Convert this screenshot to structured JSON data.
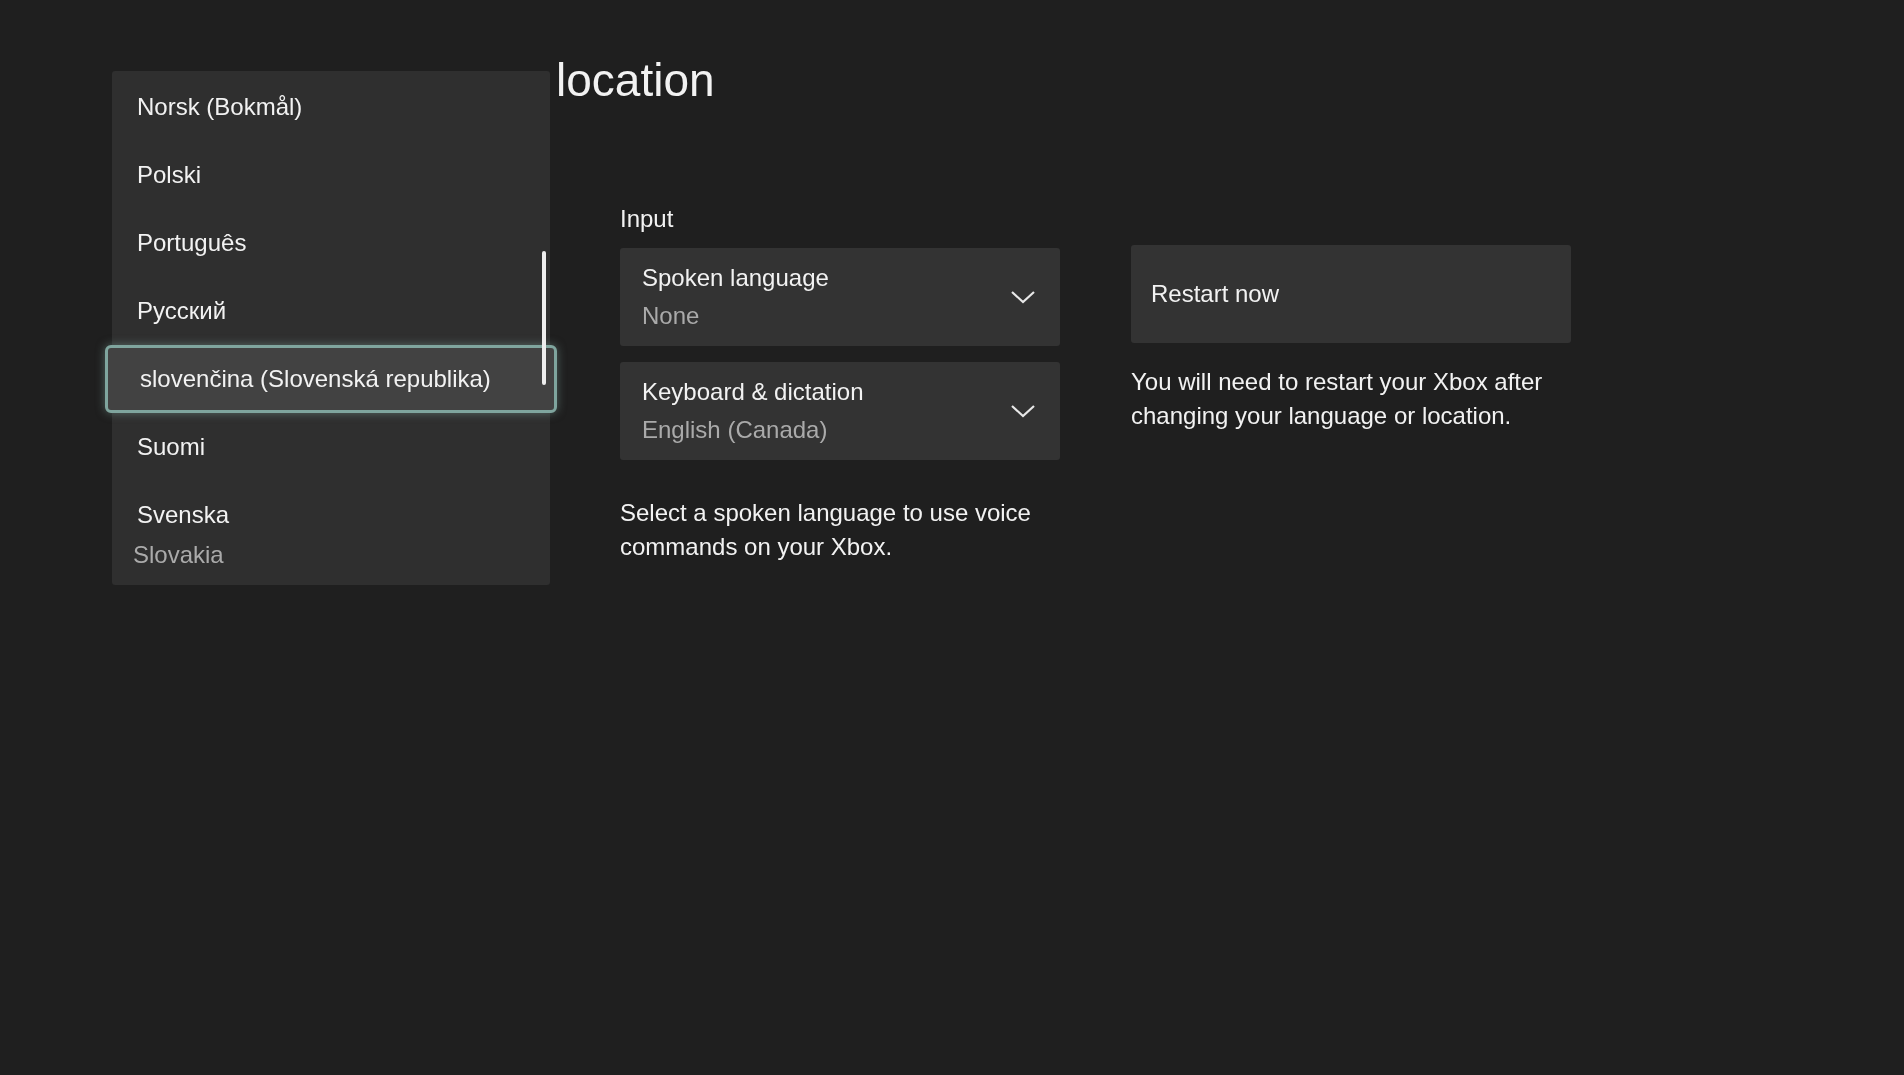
{
  "page": {
    "title": "location"
  },
  "input": {
    "heading": "Input",
    "dropdowns": [
      {
        "label": "Spoken language",
        "value": "None"
      },
      {
        "label": "Keyboard & dictation",
        "value": "English (Canada)"
      }
    ],
    "help": "Select a spoken language to use voice commands on your Xbox."
  },
  "restart": {
    "button": "Restart now",
    "note": "You will need to restart your Xbox after changing your language or location."
  },
  "language_menu": {
    "items": [
      {
        "label": "Norsk (Bokmål)",
        "selected": false
      },
      {
        "label": "Polski",
        "selected": false
      },
      {
        "label": "Português",
        "selected": false
      },
      {
        "label": "Русский",
        "selected": false
      },
      {
        "label": "slovenčina (Slovenská republika)",
        "selected": true
      },
      {
        "label": "Suomi",
        "selected": false
      },
      {
        "label": "Svenska",
        "selected": false
      }
    ],
    "underlying_value": "Slovakia"
  }
}
